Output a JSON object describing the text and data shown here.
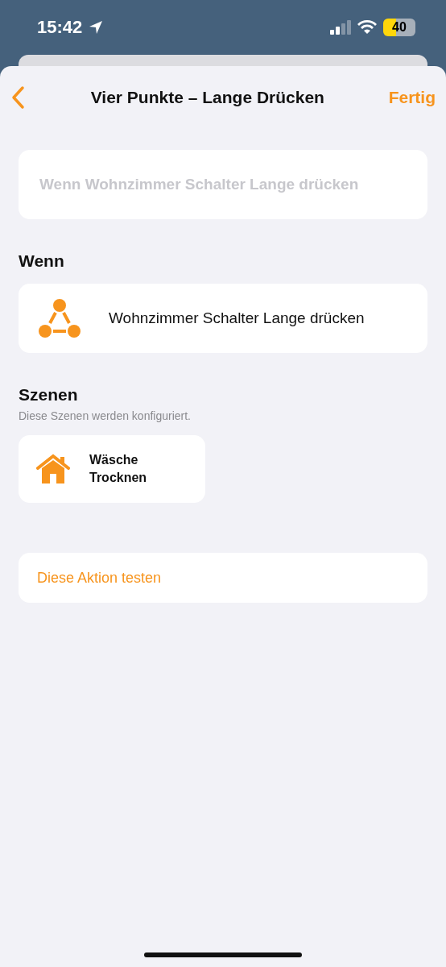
{
  "status_bar": {
    "time": "15:42",
    "battery": "40"
  },
  "nav": {
    "title": "Vier Punkte – Lange Drücken",
    "done": "Fertig"
  },
  "name_field": {
    "placeholder": "Wenn Wohnzimmer Schalter Lange drücken"
  },
  "trigger": {
    "heading": "Wenn",
    "label": "Wohnzimmer Schalter Lange drücken"
  },
  "scenes": {
    "heading": "Szenen",
    "subtitle": "Diese Szenen werden konfiguriert.",
    "items": [
      {
        "name": "Wäsche Trocknen"
      }
    ]
  },
  "test_button": "Diese Aktion testen"
}
